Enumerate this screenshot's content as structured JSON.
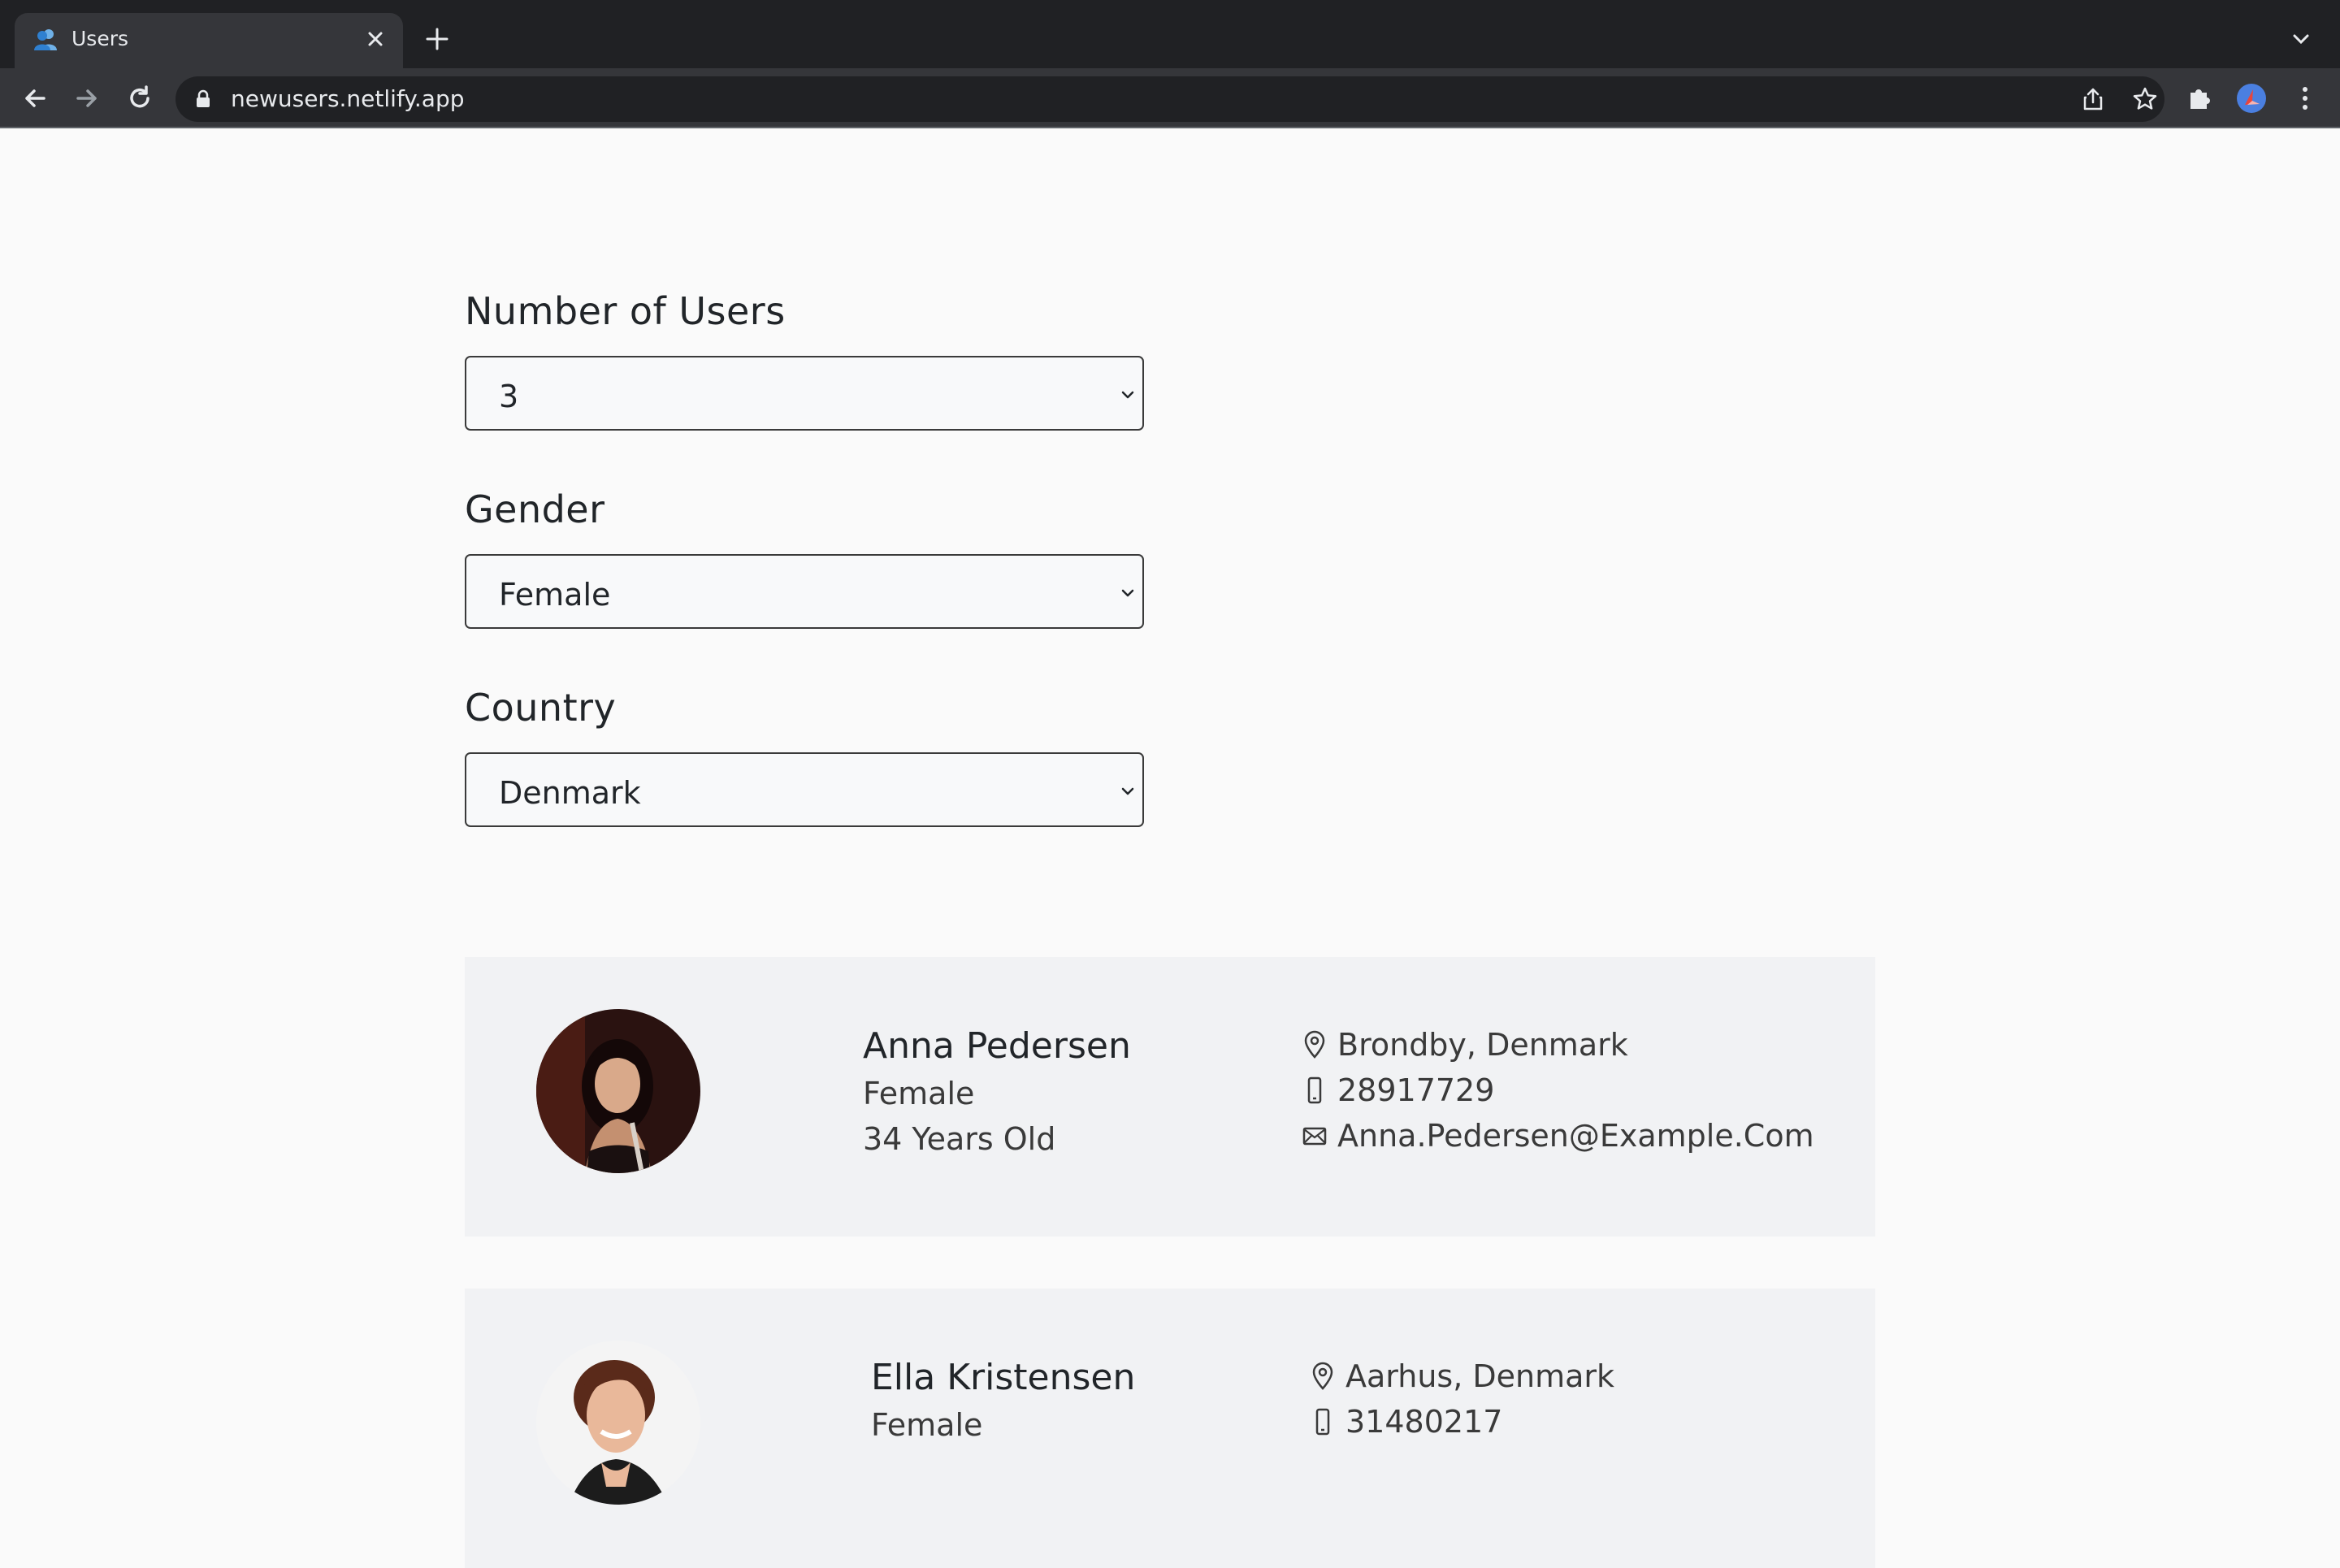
{
  "browser": {
    "tab": {
      "title": "Users",
      "favicon": "users-favicon"
    },
    "address_bar": {
      "url": "newusers.netlify.app"
    },
    "icons": {
      "back": "arrow-left-icon",
      "forward": "arrow-right-icon",
      "reload": "reload-icon",
      "share": "share-icon",
      "bookmark": "star-icon",
      "extensions": "puzzle-icon",
      "profile": "avatar-icon",
      "menu": "kebab-menu-icon"
    },
    "colors": {
      "frame": "#202124",
      "toolbar": "#35363a",
      "text": "#e8eaed"
    }
  },
  "filters": {
    "number_of_users": {
      "label": "Number of Users",
      "value": "3"
    },
    "gender": {
      "label": "Gender",
      "value": "Female"
    },
    "country": {
      "label": "Country",
      "value": "Denmark"
    }
  },
  "users": [
    {
      "name": "Anna Pedersen",
      "gender": "Female",
      "age": "34 Years Old",
      "location": "Brondby, Denmark",
      "phone": "28917729",
      "email": "Anna.Pedersen@Example.Com"
    },
    {
      "name": "Ella Kristensen",
      "gender": "Female",
      "location": "Aarhus, Denmark",
      "phone": "31480217"
    }
  ],
  "colors": {
    "page_background": "#fafafa",
    "card_background": "#f1f2f4",
    "text": "#212529"
  }
}
